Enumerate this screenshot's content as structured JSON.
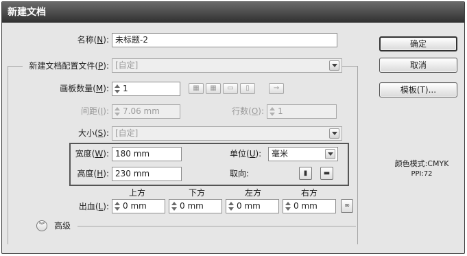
{
  "window": {
    "title": "新建文档"
  },
  "name_row": {
    "label": "名称",
    "key": "N",
    "value": "未标题-2"
  },
  "profile_row": {
    "label": "新建文档配置文件",
    "key": "P",
    "value": "[自定]"
  },
  "artboard_count": {
    "label": "画板数量",
    "key": "M",
    "value": "1"
  },
  "spacing": {
    "label": "间距",
    "key": "I",
    "value": "7.06 mm"
  },
  "columns": {
    "label": "行数",
    "key": "O",
    "value": "1"
  },
  "size_row": {
    "label": "大小",
    "key": "S",
    "value": "[自定]"
  },
  "width_row": {
    "label": "宽度",
    "key": "W",
    "value": "180 mm"
  },
  "height_row": {
    "label": "高度",
    "key": "H",
    "value": "230 mm"
  },
  "units_row": {
    "label": "单位",
    "key": "U",
    "value": "毫米"
  },
  "orientation_row": {
    "label": "取向:"
  },
  "bleed": {
    "label": "出血",
    "key": "L",
    "top_label": "上方",
    "top": "0 mm",
    "bottom_label": "下方",
    "bottom": "0 mm",
    "left_label": "左方",
    "left": "0 mm",
    "right_label": "右方",
    "right": "0 mm"
  },
  "advanced": {
    "label": "高级"
  },
  "buttons": {
    "ok": "确定",
    "cancel": "取消",
    "templates": "模板(T)..."
  },
  "info": {
    "color_mode": "颜色模式:CMYK",
    "ppi": "PPI:72"
  },
  "icons": {
    "artboard_layout": [
      "grid-by-row-icon",
      "grid-by-column-icon",
      "arrange-by-row-icon",
      "arrange-by-column-icon",
      "right-to-left-icon"
    ],
    "orientation": [
      "portrait-icon",
      "landscape-icon"
    ],
    "link": "chain-link-icon",
    "expand": "chevron-double-down-icon"
  },
  "colors": {
    "titlebar": "#3a3a3a",
    "dialog_bg": "#e6e6e6",
    "highlight_border": "#555555"
  }
}
